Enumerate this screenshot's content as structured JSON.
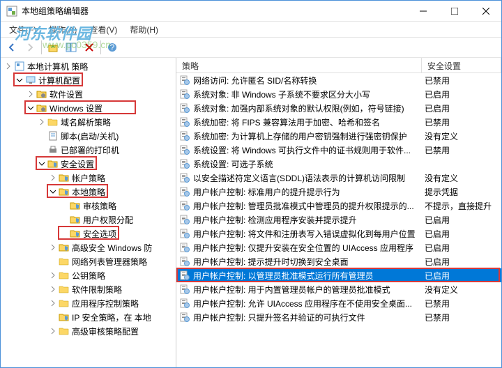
{
  "window": {
    "title": "本地组策略编辑器"
  },
  "menu": {
    "file": "文件(F)",
    "action": "操作(A)",
    "view": "查看(V)",
    "help": "帮助(H)"
  },
  "watermark": {
    "main": "河东软件园",
    "sub": "www.pc0359.cn"
  },
  "tree": {
    "root": "本地计算机 策略",
    "computer": "计算机配置",
    "software": "软件设置",
    "windows": "Windows 设置",
    "dns": "域名解析策略",
    "scripts": "脚本(启动/关机)",
    "printers": "已部署的打印机",
    "security": "安全设置",
    "account": "帐户策略",
    "local": "本地策略",
    "audit": "审核策略",
    "rights": "用户权限分配",
    "options": "安全选项",
    "firewall": "高级安全 Windows 防",
    "netlist": "网络列表管理器策略",
    "pubkey": "公钥策略",
    "restrict": "软件限制策略",
    "appctrl": "应用程序控制策略",
    "ipsec": "IP 安全策略，在 本地",
    "advaudit": "高级审核策略配置"
  },
  "columns": {
    "policy": "策略",
    "setting": "安全设置"
  },
  "policies": [
    {
      "name": "网络访问: 允许匿名 SID/名称转换",
      "setting": "已禁用"
    },
    {
      "name": "系统对象: 非 Windows 子系统不要求区分大小写",
      "setting": "已启用"
    },
    {
      "name": "系统对象: 加强内部系统对象的默认权限(例如，符号链接)",
      "setting": "已启用"
    },
    {
      "name": "系统加密: 将 FIPS 兼容算法用于加密、哈希和签名",
      "setting": "已禁用"
    },
    {
      "name": "系统加密: 为计算机上存储的用户密钥强制进行强密钥保护",
      "setting": "没有定义"
    },
    {
      "name": "系统设置: 将 Windows 可执行文件中的证书规则用于软件...",
      "setting": "已禁用"
    },
    {
      "name": "系统设置: 可选子系统",
      "setting": ""
    },
    {
      "name": "以安全描述符定义语言(SDDL)语法表示的计算机访问限制",
      "setting": "没有定义"
    },
    {
      "name": "用户帐户控制: 标准用户的提升提示行为",
      "setting": "提示凭据"
    },
    {
      "name": "用户帐户控制: 管理员批准模式中管理员的提升权限提示的...",
      "setting": "不提示，直接提升"
    },
    {
      "name": "用户帐户控制: 检测应用程序安装并提示提升",
      "setting": "已启用"
    },
    {
      "name": "用户帐户控制: 将文件和注册表写入错误虚拟化到每用户位置",
      "setting": "已启用"
    },
    {
      "name": "用户帐户控制: 仅提升安装在安全位置的 UIAccess 应用程序",
      "setting": "已启用"
    },
    {
      "name": "用户帐户控制: 提示提升时切换到安全桌面",
      "setting": "已启用"
    },
    {
      "name": "用户帐户控制: 以管理员批准模式运行所有管理员",
      "setting": "已启用"
    },
    {
      "name": "用户帐户控制: 用于内置管理员帐户的管理员批准模式",
      "setting": "没有定义"
    },
    {
      "name": "用户帐户控制: 允许 UIAccess 应用程序在不使用安全桌面...",
      "setting": "已禁用"
    },
    {
      "name": "用户帐户控制: 只提升签名并验证的可执行文件",
      "setting": "已禁用"
    }
  ],
  "selectedIndex": 14
}
